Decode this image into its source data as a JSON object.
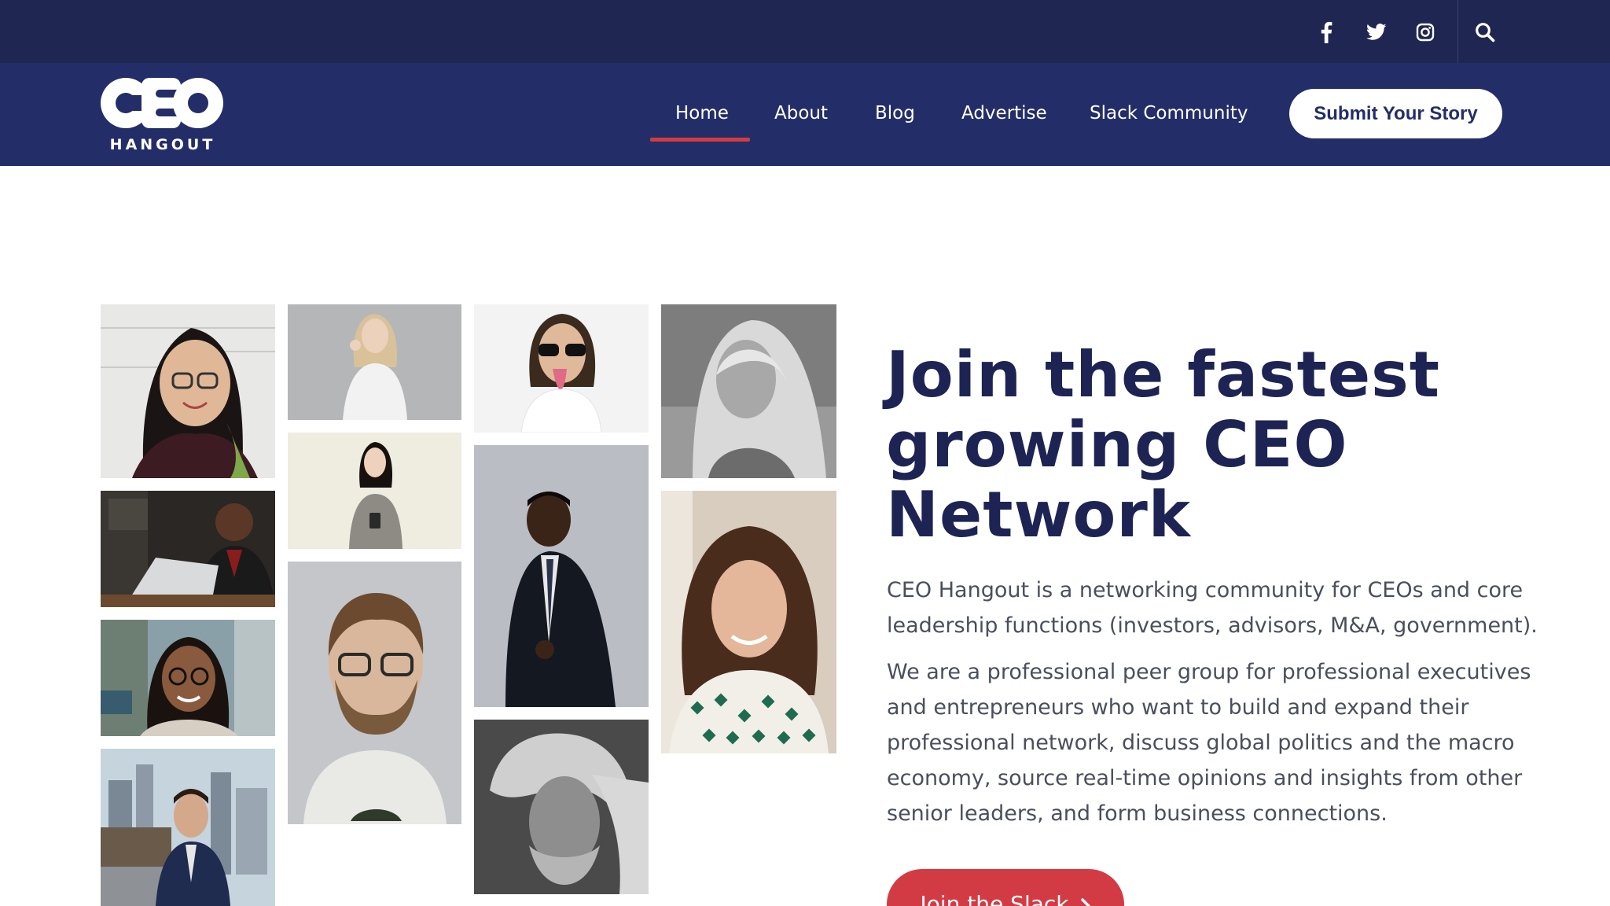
{
  "header": {
    "social": [
      {
        "icon": "facebook-icon"
      },
      {
        "icon": "twitter-icon"
      },
      {
        "icon": "instagram-icon"
      }
    ],
    "search_icon": "search-icon"
  },
  "brand": {
    "logo_main": "CEO",
    "logo_sub": "HANGOUT"
  },
  "nav": {
    "items": [
      {
        "label": "Home",
        "active": true
      },
      {
        "label": "About",
        "active": false
      },
      {
        "label": "Blog",
        "active": false
      },
      {
        "label": "Advertise",
        "active": false
      },
      {
        "label": "Slack Community",
        "active": false
      }
    ],
    "cta_label": "Submit Your Story"
  },
  "hero": {
    "title_lines": [
      "Join the fastest",
      "growing CEO",
      "Network"
    ],
    "paragraph1": "CEO Hangout is a networking community for CEOs and core leadership functions (investors, advisors, M&A, government).",
    "paragraph2": "We are a professional peer group for professional executives and entrepreneurs who want to build and expand their professional network, discuss global politics and the macro economy, source real-time opinions and insights from other senior leaders, and form business connections.",
    "cta_label": "Join the Slack",
    "cta_icon": "chevron-right-icon"
  },
  "colors": {
    "topbar": "#1f2651",
    "navbar": "#232e68",
    "accent": "#d33b44",
    "headline": "#1d2454",
    "body_text": "#4a4f5c"
  },
  "gallery": {
    "photos": [
      "portrait-woman-glasses",
      "portrait-man-laptop",
      "portrait-woman-street",
      "portrait-man-suit-city",
      "portrait-blonde-woman-white-shirt",
      "portrait-woman-phone",
      "portrait-man-glasses-beard",
      "portrait-man-sunglasses",
      "portrait-man-suit-dark",
      "portrait-man-bw-long-hair",
      "portrait-woman-bw",
      "portrait-woman-curly-hair"
    ]
  }
}
